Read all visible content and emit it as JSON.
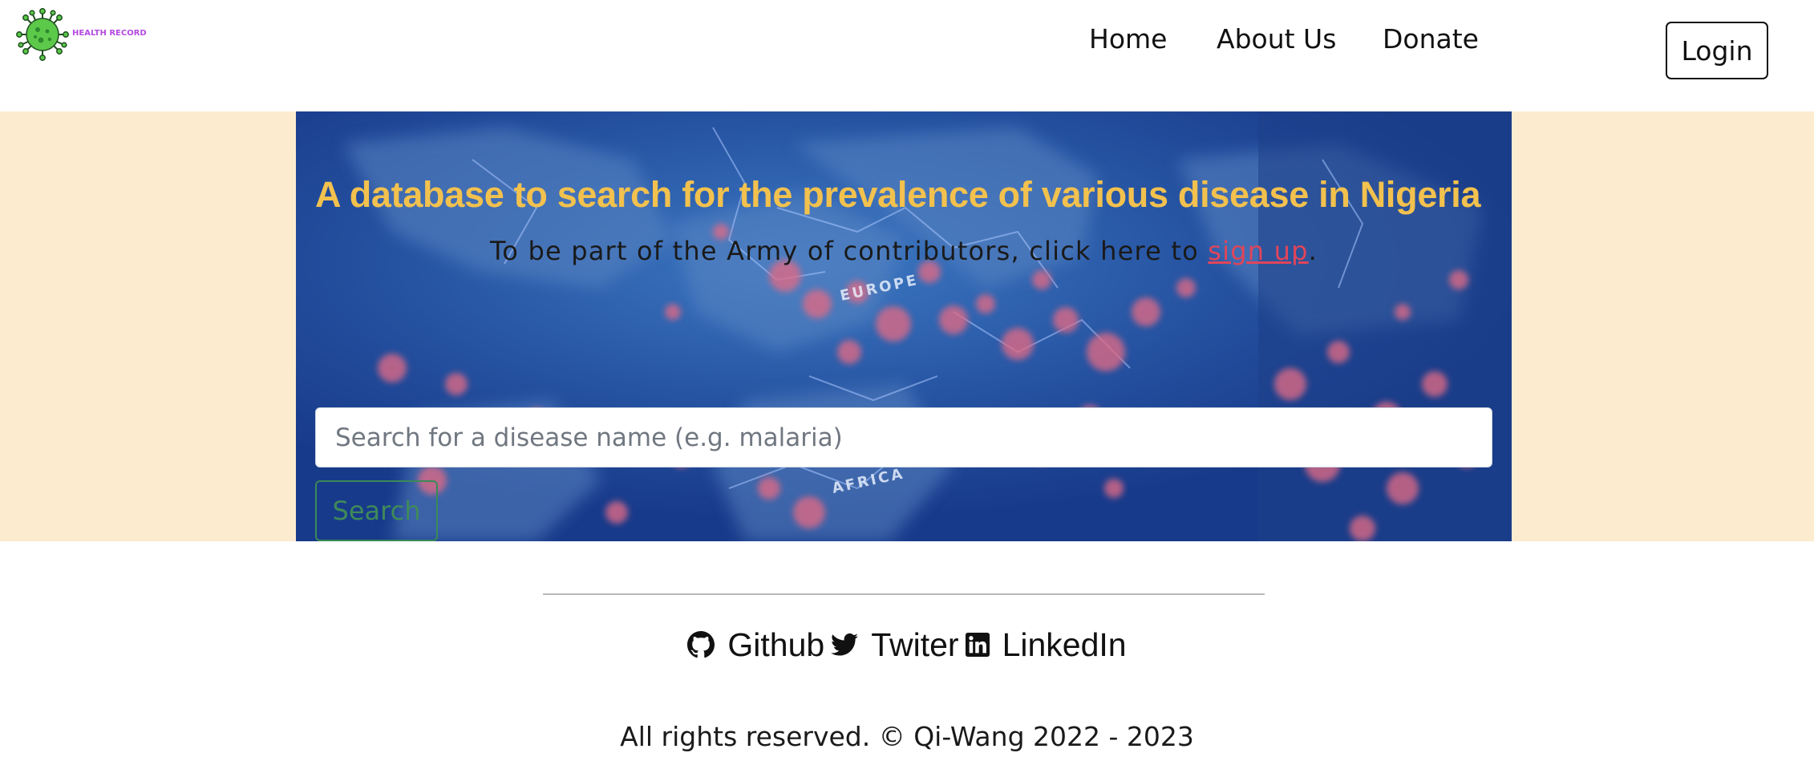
{
  "header": {
    "brand_text": "HEALTH RECORD",
    "nav": [
      "Home",
      "About Us",
      "Donate"
    ],
    "login_label": "Login"
  },
  "hero": {
    "title": "A database to search for the prevalence of various disease in Nigeria",
    "subtitle_prefix": "To be part of the Army of contributors, click here to ",
    "signup_link": "sign up",
    "subtitle_suffix": ".",
    "map_labels": {
      "europe": "EUROPE",
      "africa": "AFRICA"
    },
    "search": {
      "placeholder": "Search for a disease name (e.g. malaria)",
      "value": "",
      "button_label": "Search"
    }
  },
  "footer": {
    "links": [
      {
        "label": "Github",
        "icon": "github-icon"
      },
      {
        "label": "Twiter",
        "icon": "twitter-icon"
      },
      {
        "label": "LinkedIn",
        "icon": "linkedin-icon"
      }
    ],
    "copyright": "All rights reserved. © Qi-Wang 2022 - 2023"
  },
  "colors": {
    "hero_title": "#f2c14e",
    "hero_band": "#fcebcf",
    "signup_link": "#e0455a",
    "search_button": "#3a8a57",
    "brand_text": "#b44be0",
    "virus_green": "#5cc94a"
  }
}
